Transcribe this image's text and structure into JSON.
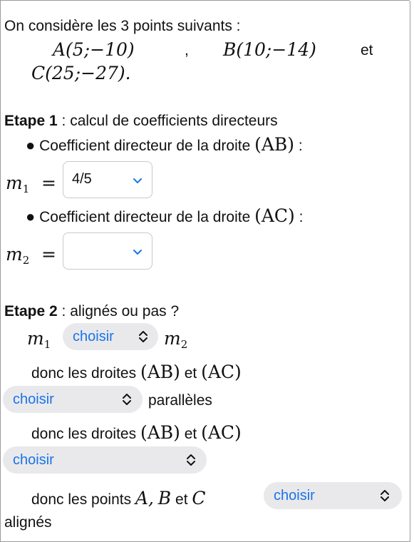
{
  "intro": {
    "text": "On considère les 3 points suivants :",
    "pointA": "A(5;−10)",
    "sep": ",",
    "pointB": "B(10;−14)",
    "et": "et",
    "pointC": "C(25;−27)."
  },
  "step1": {
    "title": "Etape 1",
    "title_rest": " : calcul de coefficients directeurs",
    "item1_text": "Coefficient directeur de la droite",
    "item1_line": "(AB)",
    "item1_colon": " :",
    "m1_label": "m",
    "m1_index": "1",
    "equals": "=",
    "m1_value": "4/5",
    "item2_text": "Coefficient directeur de la droite",
    "item2_line": "(AC)",
    "item2_colon": " :",
    "m2_label": "m",
    "m2_index": "2",
    "m2_value": ""
  },
  "step2": {
    "title": "Etape 2",
    "title_rest": " : alignés ou pas ?",
    "m1": "m",
    "m1_index": "1",
    "m2": "m",
    "m2_index": "2",
    "compare_choice": "choisir",
    "line1_prefix": "donc les droites",
    "line1_ab": "(AB)",
    "line1_et": "et",
    "line1_ac": "(AC)",
    "parallel_choice": "choisir",
    "parallel_word": "parallèles",
    "line2_prefix": "donc les droites",
    "line2_ab": "(AB)",
    "line2_et": "et",
    "line2_ac": "(AC)",
    "line2_choice": "choisir",
    "points_prefix": "donc les points",
    "points_a": "A,",
    "points_b": "B",
    "points_et": "et",
    "points_c": "C",
    "points_choice": "choisir",
    "aligned_word": "alignés"
  },
  "colors": {
    "accent": "#1a73e8",
    "pill_bg": "#e9e9ec",
    "border": "#c9c9c9"
  },
  "icons": {
    "dropdown": "chevron-down-icon",
    "select": "up-down-chevron-icon"
  }
}
